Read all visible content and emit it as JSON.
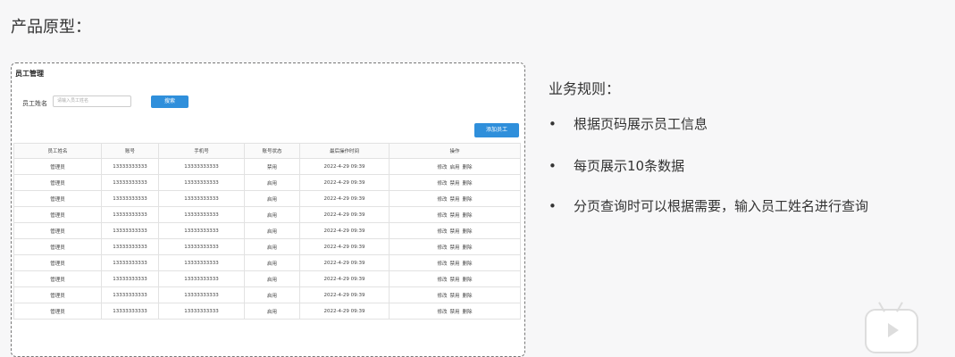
{
  "heading": "产品原型：",
  "prototype": {
    "title": "员工管理",
    "search_label": "员工姓名",
    "search_placeholder": "请输入员工姓名",
    "search_button": "搜索",
    "add_button": "添加员工",
    "columns": [
      "员工姓名",
      "账号",
      "手机号",
      "账号状态",
      "最后操作时间",
      "操作"
    ],
    "rows": [
      {
        "name": "管理员",
        "account": "13333333333",
        "phone": "13333333333",
        "status": "禁用",
        "time": "2022-4-29 09:39",
        "ops": [
          "修改",
          "启用",
          "删除"
        ]
      },
      {
        "name": "管理员",
        "account": "13333333333",
        "phone": "13333333333",
        "status": "启用",
        "time": "2022-4-29 09:39",
        "ops": [
          "修改",
          "禁用",
          "删除"
        ]
      },
      {
        "name": "管理员",
        "account": "13333333333",
        "phone": "13333333333",
        "status": "启用",
        "time": "2022-4-29 09:39",
        "ops": [
          "修改",
          "禁用",
          "删除"
        ]
      },
      {
        "name": "管理员",
        "account": "13333333333",
        "phone": "13333333333",
        "status": "启用",
        "time": "2022-4-29 09:39",
        "ops": [
          "修改",
          "禁用",
          "删除"
        ]
      },
      {
        "name": "管理员",
        "account": "13333333333",
        "phone": "13333333333",
        "status": "启用",
        "time": "2022-4-29 09:39",
        "ops": [
          "修改",
          "禁用",
          "删除"
        ]
      },
      {
        "name": "管理员",
        "account": "13333333333",
        "phone": "13333333333",
        "status": "启用",
        "time": "2022-4-29 09:39",
        "ops": [
          "修改",
          "禁用",
          "删除"
        ]
      },
      {
        "name": "管理员",
        "account": "13333333333",
        "phone": "13333333333",
        "status": "启用",
        "time": "2022-4-29 09:39",
        "ops": [
          "修改",
          "禁用",
          "删除"
        ]
      },
      {
        "name": "管理员",
        "account": "13333333333",
        "phone": "13333333333",
        "status": "启用",
        "time": "2022-4-29 09:39",
        "ops": [
          "修改",
          "禁用",
          "删除"
        ]
      },
      {
        "name": "管理员",
        "account": "13333333333",
        "phone": "13333333333",
        "status": "启用",
        "time": "2022-4-29 09:39",
        "ops": [
          "修改",
          "禁用",
          "删除"
        ]
      },
      {
        "name": "管理员",
        "account": "13333333333",
        "phone": "13333333333",
        "status": "启用",
        "time": "2022-4-29 09:39",
        "ops": [
          "修改",
          "禁用",
          "删除"
        ]
      }
    ]
  },
  "rules": {
    "title": "业务规则：",
    "bullet": "•",
    "items": [
      "根据页码展示员工信息",
      "每页展示10条数据",
      "分页查询时可以根据需要，输入员工姓名进行查询"
    ]
  },
  "colors": {
    "primary_button": "#2f8fdb"
  }
}
